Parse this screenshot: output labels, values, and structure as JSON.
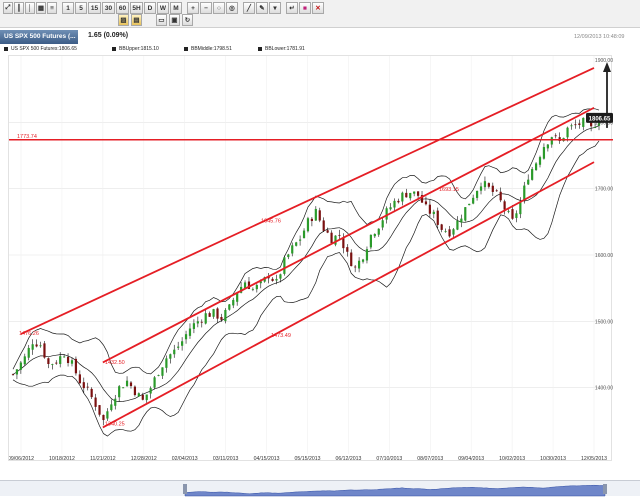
{
  "toolbar": {
    "row1": [
      {
        "name": "zoom-to-fit-icon",
        "glyph": "⤢"
      },
      {
        "name": "candlestick-icon",
        "glyph": "┃"
      },
      {
        "name": "ohlc-bar-icon",
        "glyph": "│"
      },
      {
        "name": "table-grid-icon",
        "glyph": "▦"
      },
      {
        "name": "periods-icon",
        "glyph": "≡"
      },
      {
        "name": "period-1",
        "label": "1"
      },
      {
        "name": "period-5",
        "label": "5"
      },
      {
        "name": "period-15",
        "label": "15"
      },
      {
        "name": "period-30",
        "label": "30"
      },
      {
        "name": "period-60",
        "label": "60"
      },
      {
        "name": "period-5h",
        "label": "5H"
      },
      {
        "name": "period-d",
        "label": "D"
      },
      {
        "name": "period-w",
        "label": "W"
      },
      {
        "name": "period-m",
        "label": "M"
      },
      {
        "name": "zoom-in-icon",
        "glyph": "+"
      },
      {
        "name": "zoom-out-icon",
        "glyph": "−"
      },
      {
        "name": "zoom-reset-icon",
        "glyph": "○"
      },
      {
        "name": "magnifier-icon",
        "glyph": "◎"
      },
      {
        "name": "draw-line-icon",
        "glyph": "╱"
      },
      {
        "name": "draw-tool-icon",
        "glyph": "✎"
      },
      {
        "name": "dropdown-icon",
        "glyph": "▾"
      },
      {
        "name": "cursor-icon",
        "glyph": "↵"
      },
      {
        "name": "color-picker-icon",
        "glyph": "■"
      },
      {
        "name": "delete-icon",
        "glyph": "✕"
      }
    ],
    "row2": [
      {
        "name": "indicators-icon",
        "glyph": "▨"
      },
      {
        "name": "studies-icon",
        "glyph": "▤"
      },
      {
        "name": "chart-window-icon",
        "glyph": "▭"
      },
      {
        "name": "image-icon",
        "glyph": "▣"
      },
      {
        "name": "refresh-icon",
        "glyph": "↻"
      }
    ]
  },
  "header": {
    "title": "US SPX 500 Futures (...",
    "change": "1.65 (0.09%)",
    "datetime": "12/09/2013 10:48:09"
  },
  "legend": {
    "main": "US SPX 500 Futures:1806.65",
    "upper": "BBUpper:1815.10",
    "middle": "BBMiddle:1798.51",
    "lower": "BBLower:1781.91"
  },
  "colors": {
    "channel": "#e51e25",
    "up_candle": "#2a9a2a",
    "down_candle": "#7a1010",
    "wick": "#111111",
    "band": "#1a1a1a",
    "last_price_badge": "#1c1c1c",
    "grid": "#e4e4e4"
  },
  "chart_data": {
    "type": "candlestick",
    "symbol": "US SPX 500 Futures",
    "x_tick_labels": [
      "09/06/2012",
      "10/18/2012",
      "11/21/2012",
      "12/28/2012",
      "02/04/2013",
      "03/11/2013",
      "04/15/2013",
      "05/15/2013",
      "06/12/2013",
      "07/10/2013",
      "08/07/2013",
      "09/04/2013",
      "10/02/2013",
      "10/30/2013",
      "12/05/2013"
    ],
    "y_ticks": [
      1400,
      1500,
      1600,
      1700,
      1800
    ],
    "ylim": [
      1300,
      1900
    ],
    "last_price": 1806.65,
    "bollinger": {
      "upper": 1815.1,
      "middle": 1798.51,
      "lower": 1781.91
    },
    "annotations": [
      {
        "text": "1773.74",
        "x": "09/06/2012",
        "y": 1773.74
      },
      {
        "text": "1476.26",
        "x": "09/06/2012",
        "y": 1476.26
      },
      {
        "text": "1432.50",
        "x": "11/21/2012",
        "y": 1432.5
      },
      {
        "text": "1340.25",
        "x": "11/21/2012",
        "y": 1340.25
      },
      {
        "text": "1645.76",
        "x": "04/15/2013",
        "y": 1645.76
      },
      {
        "text": "1473.49",
        "x": "04/15/2013",
        "y": 1473.49
      },
      {
        "text": "1693.15",
        "x": "08/07/2013",
        "y": 1693.15
      }
    ],
    "trendlines": [
      {
        "name": "upper-channel",
        "x1": "09/06/2012",
        "y1": 1481,
        "x2": "12/05/2013",
        "y2": 1882
      },
      {
        "name": "middle-channel",
        "x1": "11/21/2012",
        "y1": 1438,
        "x2": "12/05/2013",
        "y2": 1822
      },
      {
        "name": "lower-channel",
        "x1": "11/21/2012",
        "y1": 1340,
        "x2": "12/05/2013",
        "y2": 1740
      }
    ],
    "horizontal_line": {
      "value": 1773.74
    },
    "price_anchors": [
      [
        0,
        1420
      ],
      [
        3,
        1445
      ],
      [
        5,
        1470
      ],
      [
        7,
        1465
      ],
      [
        9,
        1435
      ],
      [
        11,
        1440
      ],
      [
        13,
        1452
      ],
      [
        15,
        1435
      ],
      [
        17,
        1410
      ],
      [
        19,
        1395
      ],
      [
        21,
        1375
      ],
      [
        23,
        1350
      ],
      [
        25,
        1380
      ],
      [
        27,
        1400
      ],
      [
        29,
        1410
      ],
      [
        31,
        1395
      ],
      [
        33,
        1380
      ],
      [
        35,
        1400
      ],
      [
        37,
        1425
      ],
      [
        39,
        1445
      ],
      [
        41,
        1455
      ],
      [
        43,
        1470
      ],
      [
        45,
        1490
      ],
      [
        47,
        1500
      ],
      [
        49,
        1510
      ],
      [
        51,
        1512
      ],
      [
        53,
        1505
      ],
      [
        55,
        1520
      ],
      [
        57,
        1545
      ],
      [
        59,
        1560
      ],
      [
        61,
        1548
      ],
      [
        63,
        1555
      ],
      [
        65,
        1570
      ],
      [
        67,
        1558
      ],
      [
        69,
        1590
      ],
      [
        71,
        1610
      ],
      [
        73,
        1625
      ],
      [
        75,
        1650
      ],
      [
        77,
        1665
      ],
      [
        79,
        1640
      ],
      [
        81,
        1625
      ],
      [
        83,
        1630
      ],
      [
        85,
        1600
      ],
      [
        87,
        1580
      ],
      [
        89,
        1600
      ],
      [
        91,
        1630
      ],
      [
        93,
        1645
      ],
      [
        95,
        1665
      ],
      [
        97,
        1680
      ],
      [
        99,
        1690
      ],
      [
        101,
        1695
      ],
      [
        103,
        1690
      ],
      [
        105,
        1670
      ],
      [
        107,
        1660
      ],
      [
        109,
        1640
      ],
      [
        111,
        1635
      ],
      [
        113,
        1650
      ],
      [
        115,
        1670
      ],
      [
        117,
        1690
      ],
      [
        119,
        1710
      ],
      [
        121,
        1700
      ],
      [
        123,
        1690
      ],
      [
        125,
        1670
      ],
      [
        127,
        1650
      ],
      [
        129,
        1680
      ],
      [
        131,
        1720
      ],
      [
        133,
        1740
      ],
      [
        135,
        1765
      ],
      [
        137,
        1780
      ],
      [
        139,
        1770
      ],
      [
        141,
        1790
      ],
      [
        143,
        1795
      ],
      [
        145,
        1800
      ],
      [
        147,
        1790
      ],
      [
        149,
        1806.65
      ]
    ]
  },
  "scroller": {
    "label": "period-scroller"
  }
}
